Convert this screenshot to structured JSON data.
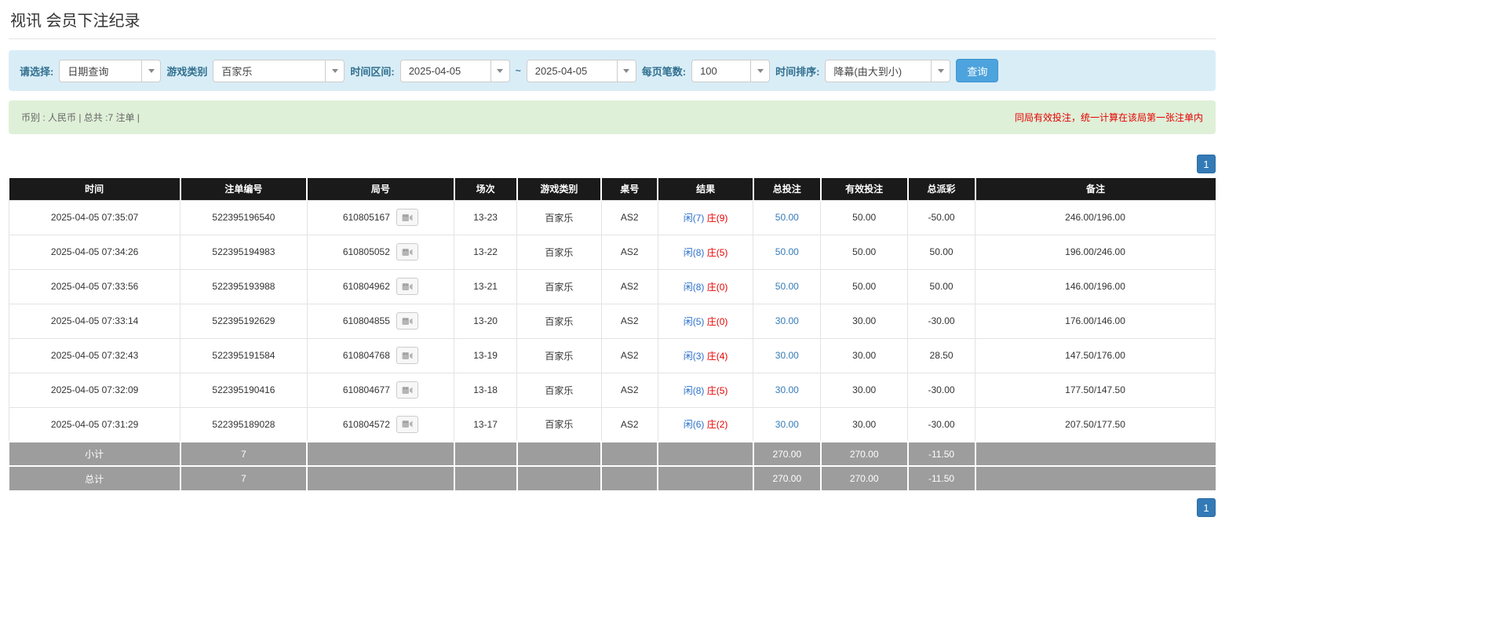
{
  "page": {
    "title": "视讯 会员下注纪录"
  },
  "filters": {
    "select_label": "请选择:",
    "select_value": "日期查询",
    "game_type_label": "游戏类别",
    "game_type_value": "百家乐",
    "time_range_label": "时间区间:",
    "date_from": "2025-04-05",
    "tilde": "~",
    "date_to": "2025-04-05",
    "page_size_label": "每页笔数:",
    "page_size_value": "100",
    "sort_label": "时间排序:",
    "sort_value": "降幕(由大到小)",
    "search_button": "查询"
  },
  "info_bar": {
    "summary": "币别 : 人民币 | 总共 :7 注单 |",
    "notice": "同局有效投注，统一计算在该局第一张注单内"
  },
  "pagination": {
    "page": "1"
  },
  "colors": {
    "accent_blue": "#337ab7",
    "button_blue": "#4da3dd",
    "filter_bg": "#d9edf7",
    "info_bg": "#dff0d8",
    "header_bg": "#1a1a1a",
    "footer_bg": "#9d9d9d",
    "negative_red": "#ff0000",
    "player_blue": "#2a6fc9",
    "banker_red": "#e60000"
  },
  "icons": {
    "video_replay": "video-camera-icon",
    "dropdown_caret": "chevron-down-icon"
  },
  "table": {
    "headers": [
      "时间",
      "注单编号",
      "局号",
      "场次",
      "游戏类别",
      "桌号",
      "结果",
      "总投注",
      "有效投注",
      "总派彩",
      "备注"
    ],
    "rows": [
      {
        "time": "2025-04-05 07:35:07",
        "bet_id": "522395196540",
        "round_id": "610805167",
        "session": "13-23",
        "game": "百家乐",
        "table_no": "AS2",
        "result_player": "闲(7)",
        "result_banker": "庄(9)",
        "total_bet": "50.00",
        "valid_bet": "50.00",
        "payout": "-50.00",
        "remark": "246.00/196.00"
      },
      {
        "time": "2025-04-05 07:34:26",
        "bet_id": "522395194983",
        "round_id": "610805052",
        "session": "13-22",
        "game": "百家乐",
        "table_no": "AS2",
        "result_player": "闲(8)",
        "result_banker": "庄(5)",
        "total_bet": "50.00",
        "valid_bet": "50.00",
        "payout": "50.00",
        "remark": "196.00/246.00"
      },
      {
        "time": "2025-04-05 07:33:56",
        "bet_id": "522395193988",
        "round_id": "610804962",
        "session": "13-21",
        "game": "百家乐",
        "table_no": "AS2",
        "result_player": "闲(8)",
        "result_banker": "庄(0)",
        "total_bet": "50.00",
        "valid_bet": "50.00",
        "payout": "50.00",
        "remark": "146.00/196.00"
      },
      {
        "time": "2025-04-05 07:33:14",
        "bet_id": "522395192629",
        "round_id": "610804855",
        "session": "13-20",
        "game": "百家乐",
        "table_no": "AS2",
        "result_player": "闲(5)",
        "result_banker": "庄(0)",
        "total_bet": "30.00",
        "valid_bet": "30.00",
        "payout": "-30.00",
        "remark": "176.00/146.00"
      },
      {
        "time": "2025-04-05 07:32:43",
        "bet_id": "522395191584",
        "round_id": "610804768",
        "session": "13-19",
        "game": "百家乐",
        "table_no": "AS2",
        "result_player": "闲(3)",
        "result_banker": "庄(4)",
        "total_bet": "30.00",
        "valid_bet": "30.00",
        "payout": "28.50",
        "remark": "147.50/176.00"
      },
      {
        "time": "2025-04-05 07:32:09",
        "bet_id": "522395190416",
        "round_id": "610804677",
        "session": "13-18",
        "game": "百家乐",
        "table_no": "AS2",
        "result_player": "闲(8)",
        "result_banker": "庄(5)",
        "total_bet": "30.00",
        "valid_bet": "30.00",
        "payout": "-30.00",
        "remark": "177.50/147.50"
      },
      {
        "time": "2025-04-05 07:31:29",
        "bet_id": "522395189028",
        "round_id": "610804572",
        "session": "13-17",
        "game": "百家乐",
        "table_no": "AS2",
        "result_player": "闲(6)",
        "result_banker": "庄(2)",
        "total_bet": "30.00",
        "valid_bet": "30.00",
        "payout": "-30.00",
        "remark": "207.50/177.50"
      }
    ],
    "subtotal": {
      "label": "小计",
      "count": "7",
      "total_bet": "270.00",
      "valid_bet": "270.00",
      "payout": "-11.50"
    },
    "total": {
      "label": "总计",
      "count": "7",
      "total_bet": "270.00",
      "valid_bet": "270.00",
      "payout": "-11.50"
    }
  }
}
